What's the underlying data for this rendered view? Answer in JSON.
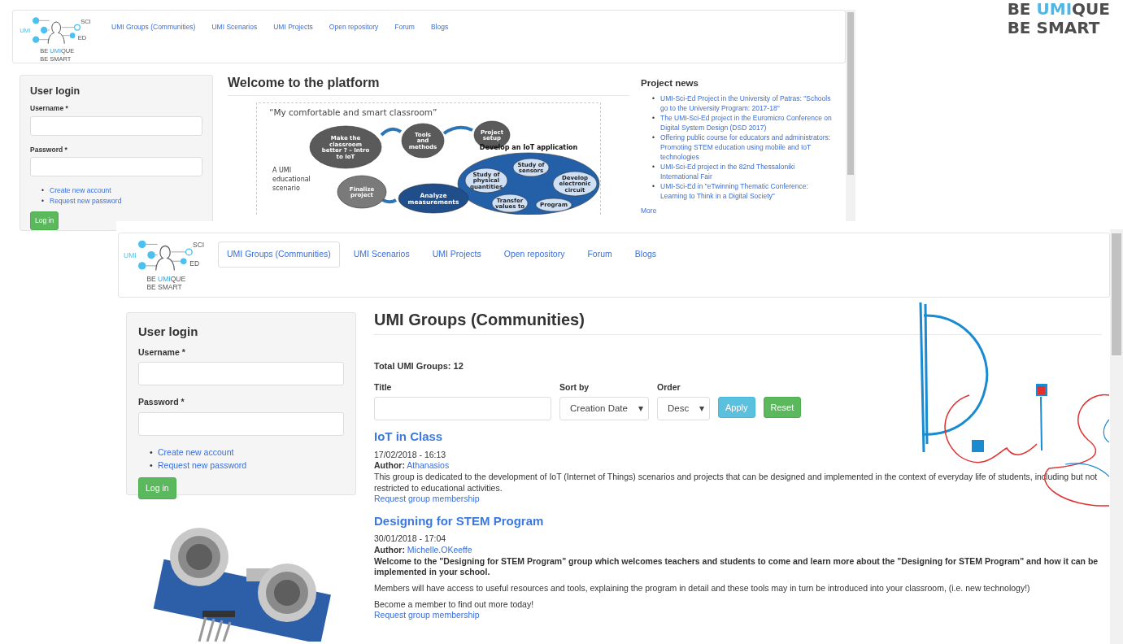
{
  "back_window": {
    "nav": {
      "logo": {
        "left_label": "UMI",
        "right_labels": [
          "SCI",
          "ED"
        ],
        "tagline_prefix": "BE ",
        "tagline_highlight": "UMI",
        "tagline_suffix": "QUE",
        "tagline_line2": "BE SMART"
      },
      "links": [
        {
          "label": "UMI Groups (Communities)",
          "selected": false
        },
        {
          "label": "UMI Scenarios",
          "selected": false
        },
        {
          "label": "UMI Projects",
          "selected": false
        },
        {
          "label": "Open repository",
          "selected": false
        },
        {
          "label": "Forum",
          "selected": false
        },
        {
          "label": "Blogs",
          "selected": false
        }
      ]
    },
    "login": {
      "title": "User login",
      "username_label": "Username *",
      "password_label": "Password *",
      "bullet": "•",
      "links": [
        "Create new account",
        "Request new password"
      ],
      "button": "Log in"
    },
    "main": {
      "title": "Welcome to the platform",
      "diagram": {
        "title": "“My comfortable and smart classroom”",
        "caption": [
          "A UMI",
          "educational",
          "scenario"
        ],
        "nodes": [
          {
            "kind": "step",
            "lines": [
              "Make the",
              "classroom",
              "better ? – Intro",
              "to IoT"
            ]
          },
          {
            "kind": "step",
            "lines": [
              "Tools",
              "and",
              "methods"
            ]
          },
          {
            "kind": "step",
            "lines": [
              "Project",
              "setup"
            ]
          },
          {
            "kind": "group",
            "lines": [
              "Develop an IoT application"
            ]
          },
          {
            "kind": "substep",
            "lines": [
              "Study of",
              "physical",
              "quantities"
            ]
          },
          {
            "kind": "substep",
            "lines": [
              "Study of",
              "sensors"
            ]
          },
          {
            "kind": "substep",
            "lines": [
              "Develop",
              "electronic",
              "circuit"
            ]
          },
          {
            "kind": "substep",
            "lines": [
              "Transfer",
              "values to"
            ]
          },
          {
            "kind": "substep",
            "lines": [
              "Program"
            ]
          },
          {
            "kind": "finish",
            "lines": [
              "Finalize",
              "project"
            ]
          },
          {
            "kind": "process",
            "lines": [
              "Analyze",
              "measurements"
            ]
          }
        ]
      }
    },
    "news": {
      "title": "Project news",
      "bullet": "•",
      "items": [
        "UMI-Sci-Ed Project in the University of Patras: \"Schools go to the University Program: 2017-18\"",
        "The UMI-Sci-Ed project in the Euromicro Conference on Digital System Design (DSD 2017)",
        "Offering public course for educators and administrators: Promoting STEM education using mobile and IoT technologies",
        "UMI-Sci-Ed project in the 82nd Thessaloniki International Fair",
        "UMI-Sci-Ed in \"eTwinning Thematic Conference: Learning to Think in a Digital Society\""
      ],
      "more": "More"
    }
  },
  "brand": {
    "prefix": "BE ",
    "highlight": "UMI",
    "suffix": "QUE",
    "line2": "BE SMART"
  },
  "front_window": {
    "nav": {
      "logo": {
        "left_label": "UMI",
        "right_labels": [
          "SCI",
          "ED"
        ],
        "tagline_prefix": "BE ",
        "tagline_highlight": "UMI",
        "tagline_suffix": "QUE",
        "tagline_line2": "BE SMART"
      },
      "links": [
        {
          "label": "UMI Groups (Communities)",
          "selected": true
        },
        {
          "label": "UMI Scenarios",
          "selected": false
        },
        {
          "label": "UMI Projects",
          "selected": false
        },
        {
          "label": "Open repository",
          "selected": false
        },
        {
          "label": "Forum",
          "selected": false
        },
        {
          "label": "Blogs",
          "selected": false
        }
      ]
    },
    "login": {
      "title": "User login",
      "username_label": "Username *",
      "password_label": "Password *",
      "bullet": "•",
      "links": [
        "Create new account",
        "Request new password"
      ],
      "button": "Log in"
    },
    "main": {
      "title": "UMI Groups (Communities)",
      "total": "Total UMI Groups: 12",
      "filters": {
        "title_label": "Title",
        "sort_label": "Sort by",
        "sort_value": "Creation Date",
        "order_label": "Order",
        "order_value": "Desc",
        "caret": "▾",
        "apply": "Apply",
        "reset": "Reset"
      },
      "groups": [
        {
          "title": "IoT in Class",
          "date": "17/02/2018 - 16:13",
          "author_label": "Author:",
          "author": "Athanasios",
          "paragraphs": [
            {
              "text": "This group is dedicated to the development of IoT (Internet of Things) scenarios and projects that can be designed and implemented in the context of everyday life of students, including but not restricted to educational activities.",
              "bold": false
            }
          ],
          "link": "Request group membership"
        },
        {
          "title": "Designing for STEM Program",
          "date": "30/01/2018 - 17:04",
          "author_label": "Author:",
          "author": "Michelle.OKeeffe",
          "paragraphs": [
            {
              "text": "Welcome to the \"Designing for STEM Program\" group which welcomes teachers and students to come and learn more about the \"Designing for STEM Program\" and how it can be implemented in your school.",
              "bold": true
            },
            {
              "text": "Members will have access to useful resources and tools, explaining the program in detail and these tools may in turn be introduced into your classroom, (i.e. new technology!)",
              "bold": false
            },
            {
              "text": "Become a member to find out more today!",
              "bold": false
            }
          ],
          "link": "Request group membership"
        }
      ]
    }
  }
}
